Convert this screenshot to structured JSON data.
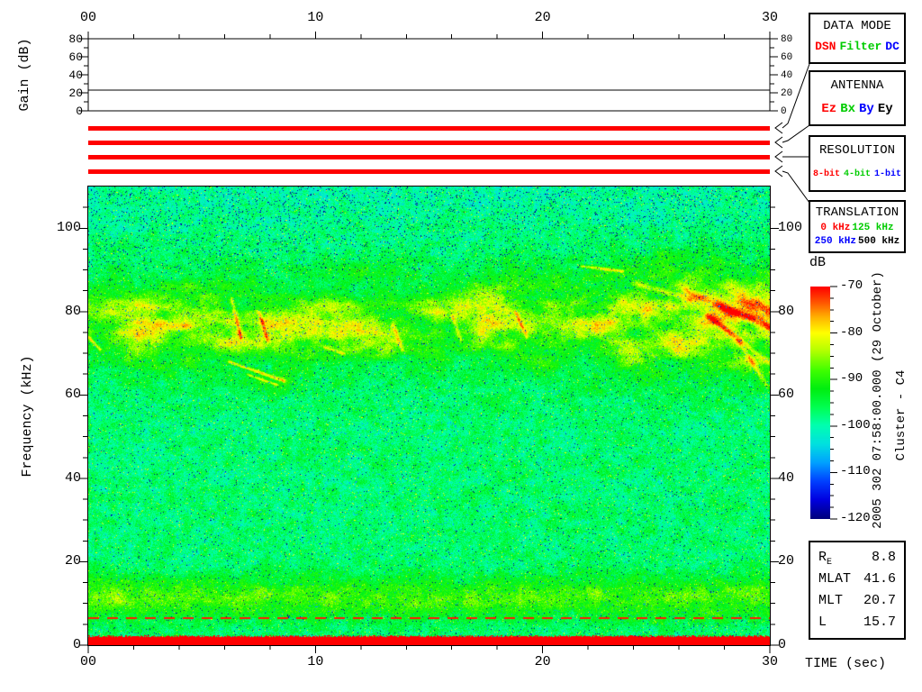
{
  "gain_panel": {
    "ylabel": "Gain (dB)",
    "yticks": [
      80,
      60,
      40,
      20,
      0
    ],
    "minor_yticks": [
      70,
      50,
      30,
      10
    ],
    "y_range": [
      0,
      80
    ],
    "gain_line_db": 23
  },
  "time_axis": {
    "tick_labels": [
      "00",
      "10",
      "20",
      "30"
    ],
    "tick_values": [
      0,
      10,
      20,
      30
    ],
    "minor_step_sec": 2,
    "range_sec": [
      0,
      30
    ]
  },
  "freq_axis": {
    "label": "Frequency (kHz)",
    "tick_values": [
      100,
      80,
      60,
      40,
      20,
      0
    ],
    "minor_step_khz": 5,
    "range_khz": [
      0,
      110
    ]
  },
  "status_bars": {
    "color": "#ff0000",
    "linked_boxes": [
      "DATA MODE",
      "ANTENNA",
      "RESOLUTION",
      "TRANSLATION"
    ]
  },
  "legend_boxes": [
    {
      "title": "DATA MODE",
      "options": [
        {
          "label": "DSN",
          "color": "#ff0000"
        },
        {
          "label": "Filter",
          "color": "#00cc00"
        },
        {
          "label": "DC",
          "color": "#0000ff"
        }
      ]
    },
    {
      "title": "ANTENNA",
      "options": [
        {
          "label": "Ez",
          "color": "#ff0000"
        },
        {
          "label": "Bx",
          "color": "#00cc00"
        },
        {
          "label": "By",
          "color": "#0000ff"
        },
        {
          "label": "Ey",
          "color": "#000000"
        }
      ]
    },
    {
      "title": "RESOLUTION",
      "options": [
        {
          "label": "8-bit",
          "color": "#ff0000"
        },
        {
          "label": "4-bit",
          "color": "#00cc00"
        },
        {
          "label": "1-bit",
          "color": "#0000ff"
        }
      ]
    },
    {
      "title": "TRANSLATION",
      "row1": [
        {
          "label": "0 kHz",
          "color": "#ff0000"
        },
        {
          "label": "125 kHz",
          "color": "#00cc00"
        }
      ],
      "row2": [
        {
          "label": "250 kHz",
          "color": "#0000ff"
        },
        {
          "label": "500 kHz",
          "color": "#000000"
        }
      ]
    }
  ],
  "colorbar": {
    "label": "dB",
    "tick_values": [
      -70,
      -80,
      -90,
      -100,
      -110,
      -120
    ],
    "minor_step_db": 2.5,
    "range_db": [
      -120,
      -70
    ]
  },
  "side_text": {
    "timestamp": "2005 302 07:58:00.000 (29 October)",
    "spacecraft": "Cluster - C4"
  },
  "info_box": {
    "rows": [
      {
        "label": "R",
        "sub": "E",
        "value": "8.8"
      },
      {
        "label": "MLAT",
        "sub": "",
        "value": "41.6"
      },
      {
        "label": "MLT",
        "sub": "",
        "value": "20.7"
      },
      {
        "label": "L",
        "sub": "",
        "value": "15.7"
      }
    ]
  },
  "time_label": "TIME (sec)",
  "chart_data": [
    {
      "type": "line",
      "name": "receiver-gain",
      "ylabel": "Gain (dB)",
      "y_range": [
        0,
        80
      ],
      "x_range_sec": [
        0,
        30
      ],
      "series": [
        {
          "name": "gain",
          "constant_db": 23
        }
      ]
    },
    {
      "type": "heatmap",
      "name": "wbd-spectrogram",
      "xlabel": "TIME (sec)",
      "ylabel": "Frequency (kHz)",
      "x_range_sec": [
        0,
        30
      ],
      "y_range_khz": [
        0,
        110
      ],
      "color_scale": {
        "label": "dB",
        "min": -120,
        "max": -70,
        "stops": [
          [
            0.0,
            "#000080"
          ],
          [
            0.08,
            "#0000e0"
          ],
          [
            0.16,
            "#0040ff"
          ],
          [
            0.24,
            "#00a0ff"
          ],
          [
            0.32,
            "#00e0e0"
          ],
          [
            0.4,
            "#00ffb0"
          ],
          [
            0.48,
            "#00ff50"
          ],
          [
            0.56,
            "#00ee10"
          ],
          [
            0.64,
            "#40ff00"
          ],
          [
            0.72,
            "#b0ff00"
          ],
          [
            0.8,
            "#ffff00"
          ],
          [
            0.87,
            "#ffb000"
          ],
          [
            0.93,
            "#ff5800"
          ],
          [
            1.0,
            "#ff0000"
          ]
        ]
      },
      "background_db": -97,
      "features": [
        {
          "name": "emission-band",
          "f_center_khz": 77.5,
          "f_width_khz": 11,
          "gain_db": 30,
          "t_range": [
            0,
            30
          ]
        },
        {
          "name": "intense-right-region",
          "t_start_sec": 18,
          "f_center_khz": 79,
          "f_width_khz": 13,
          "gain_db": 20
        },
        {
          "name": "low-band",
          "f_center_khz": 11.5,
          "f_width_khz": 5,
          "gain_db": 12
        },
        {
          "name": "interference-dashed-line",
          "f_khz": 6.5,
          "db": -71,
          "style": "dashed"
        },
        {
          "name": "bottom-band",
          "f_max_khz": 2.0,
          "db": -70
        },
        {
          "name": "cyan-upper-region",
          "f_above_khz": 90,
          "db_per_khz": -0.12
        },
        {
          "name": "noise-speckle",
          "dark_db": -119,
          "blue_db": -108,
          "dark_density": 0.012,
          "blue_density": 0.023
        }
      ],
      "streaks": [
        [
          0.0,
          74,
          0.5,
          71,
          14,
          1.3
        ],
        [
          6.3,
          83,
          6.7,
          74,
          11,
          1.8
        ],
        [
          6.2,
          68,
          8.6,
          63.5,
          15,
          1.4
        ],
        [
          7.0,
          65,
          8.3,
          62.5,
          12,
          1.1
        ],
        [
          7.5,
          80,
          7.9,
          73,
          10,
          1.6
        ],
        [
          10.4,
          71.5,
          11.2,
          70,
          9,
          1.3
        ],
        [
          13.4,
          77,
          13.8,
          71,
          9,
          1.6
        ],
        [
          16.0,
          79,
          16.4,
          73,
          8,
          1.5
        ],
        [
          18.8,
          80,
          19.3,
          74,
          8,
          1.5
        ],
        [
          21.7,
          91,
          23.5,
          89.8,
          13,
          1.3
        ],
        [
          24.0,
          87,
          26.5,
          83,
          9,
          2.6
        ],
        [
          26.3,
          85,
          29.9,
          76.5,
          11,
          3.2
        ],
        [
          27.3,
          79,
          29.9,
          68,
          9,
          2.4
        ],
        [
          28.6,
          73,
          29.9,
          62,
          8,
          1.8
        ]
      ]
    }
  ]
}
